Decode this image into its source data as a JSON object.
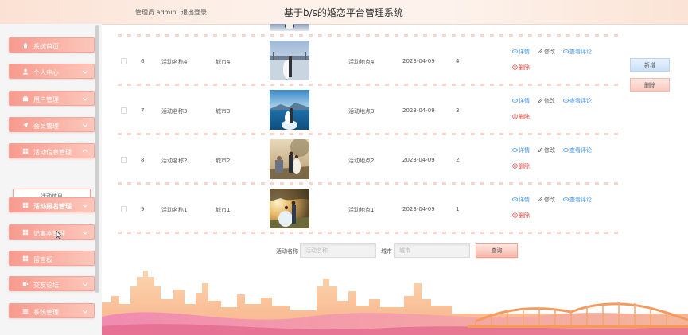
{
  "header": {
    "admin_label": "管理员 admin",
    "logout_label": "退出登录",
    "title": "基于b/s的婚恋平台管理系统"
  },
  "sidebar": {
    "items": [
      {
        "label": "系统首页",
        "icon": "home-icon",
        "has_chevron": false
      },
      {
        "label": "个人中心",
        "icon": "user-icon",
        "has_chevron": true
      },
      {
        "label": "用户管理",
        "icon": "briefcase-icon",
        "has_chevron": true
      },
      {
        "label": "会员管理",
        "icon": "send-icon",
        "has_chevron": true
      },
      {
        "label": "活动信息管理",
        "icon": "grid-icon",
        "has_chevron": true
      },
      {
        "label": "活动报名管理",
        "icon": "grid-icon",
        "has_chevron": true
      },
      {
        "label": "记事本管理",
        "icon": "grid-icon",
        "has_chevron": true
      },
      {
        "label": "留言板",
        "icon": "grid-icon",
        "has_chevron": false
      },
      {
        "label": "交友论坛",
        "icon": "video-icon",
        "has_chevron": true
      },
      {
        "label": "系统管理",
        "icon": "list-icon",
        "has_chevron": true
      }
    ],
    "submenu_label": "活动信息"
  },
  "table": {
    "rows": [
      {
        "index": "6",
        "name": "活动名称4",
        "city": "城市4",
        "location": "活动地点4",
        "date": "2023-04-09",
        "count": "4",
        "photo": "bridge"
      },
      {
        "index": "7",
        "name": "活动名称3",
        "city": "城市3",
        "location": "活动地点3",
        "date": "2023-04-09",
        "count": "3",
        "photo": "sea"
      },
      {
        "index": "8",
        "name": "活动名称2",
        "city": "城市2",
        "location": "活动地点2",
        "date": "2023-04-09",
        "count": "2",
        "photo": "tree"
      },
      {
        "index": "9",
        "name": "活动名称1",
        "city": "城市1",
        "location": "活动地点1",
        "date": "2023-04-09",
        "count": "1",
        "photo": "sunset"
      }
    ],
    "actions": {
      "detail": "详情",
      "edit": "修改",
      "comments": "查看评论",
      "delete": "删除"
    }
  },
  "buttons": {
    "add": "新增",
    "delete": "删除"
  },
  "search": {
    "name_label": "活动名称",
    "name_placeholder": "活动名称",
    "city_label": "城市",
    "city_placeholder": "城市",
    "query_button": "查询"
  },
  "colors": {
    "accent": "#f8a699",
    "link_blue": "#3a8ee6",
    "danger": "#e2433a"
  }
}
